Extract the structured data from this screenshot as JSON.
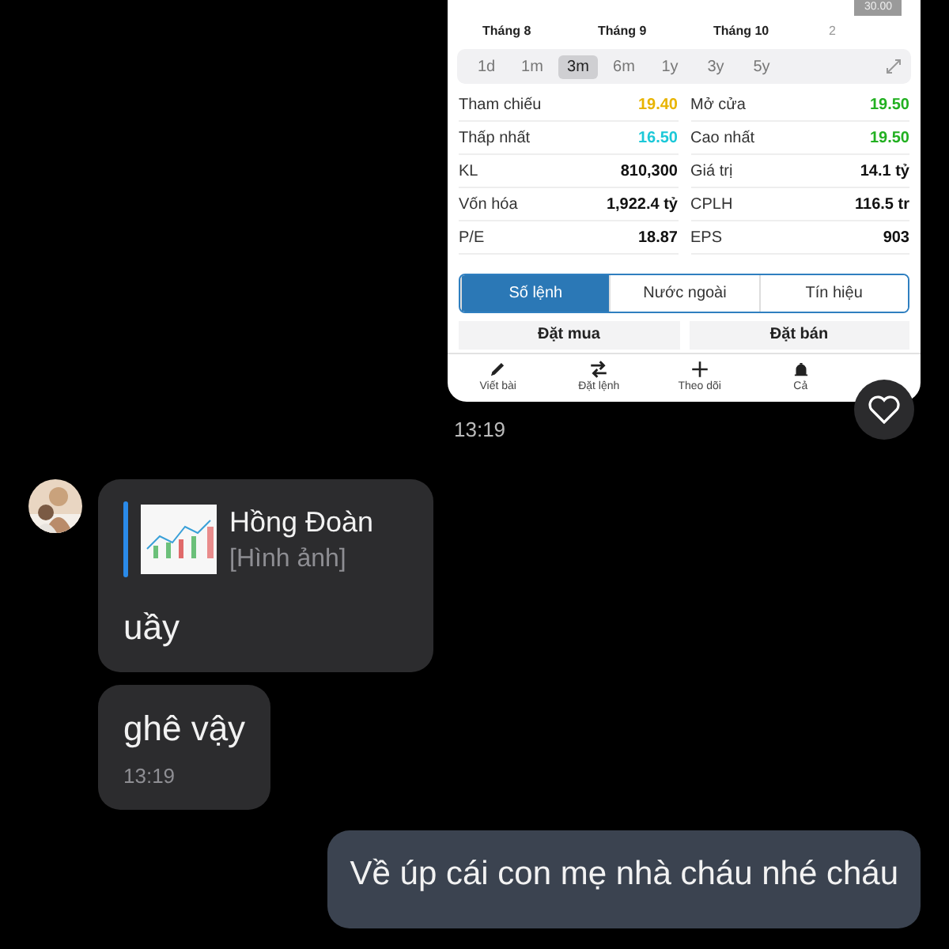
{
  "stock_card": {
    "price_tag": "30.00",
    "months": [
      "Tháng 8",
      "Tháng 9",
      "Tháng 10",
      "2"
    ],
    "periods": [
      {
        "label": "1d",
        "selected": false
      },
      {
        "label": "1m",
        "selected": false
      },
      {
        "label": "3m",
        "selected": true
      },
      {
        "label": "6m",
        "selected": false
      },
      {
        "label": "1y",
        "selected": false
      },
      {
        "label": "3y",
        "selected": false
      },
      {
        "label": "5y",
        "selected": false
      }
    ],
    "stats": [
      {
        "label": "Tham chiếu",
        "value": "19.40",
        "color": "#e8b400"
      },
      {
        "label": "Mở cửa",
        "value": "19.50",
        "color": "#22b021"
      },
      {
        "label": "Thấp nhất",
        "value": "16.50",
        "color": "#1cc8d8"
      },
      {
        "label": "Cao nhất",
        "value": "19.50",
        "color": "#22b021"
      },
      {
        "label": "KL",
        "value": "810,300",
        "color": "#111111"
      },
      {
        "label": "Giá trị",
        "value": "14.1 tỷ",
        "color": "#111111"
      },
      {
        "label": "Vốn hóa",
        "value": "1,922.4 tỷ",
        "color": "#111111"
      },
      {
        "label": "CPLH",
        "value": "116.5 tr",
        "color": "#111111"
      },
      {
        "label": "P/E",
        "value": "18.87",
        "color": "#111111"
      },
      {
        "label": "EPS",
        "value": "903",
        "color": "#111111"
      }
    ],
    "tabs": [
      {
        "label": "Số lệnh",
        "selected": true
      },
      {
        "label": "Nước ngoài",
        "selected": false
      },
      {
        "label": "Tín hiệu",
        "selected": false
      }
    ],
    "order_headers": [
      "Đặt mua",
      "Đặt bán"
    ],
    "nav": [
      {
        "label": "Viết bài",
        "kind": "pencil"
      },
      {
        "label": "Đặt lệnh",
        "kind": "swap"
      },
      {
        "label": "Theo dõi",
        "kind": "plus"
      },
      {
        "label": "Cả",
        "kind": "bell"
      }
    ]
  },
  "card_time": "13:19",
  "messages": [
    {
      "kind": "incoming",
      "avatar": true,
      "quote": {
        "name": "Hồng Đoàn",
        "type_label": "[Hình ảnh]"
      },
      "text": "uầy"
    },
    {
      "kind": "incoming",
      "avatar": false,
      "text": "ghê vậy",
      "time": "13:19"
    },
    {
      "kind": "outgoing",
      "avatar": false,
      "text": "Về úp cái con mẹ nhà cháu nhé cháu"
    }
  ]
}
